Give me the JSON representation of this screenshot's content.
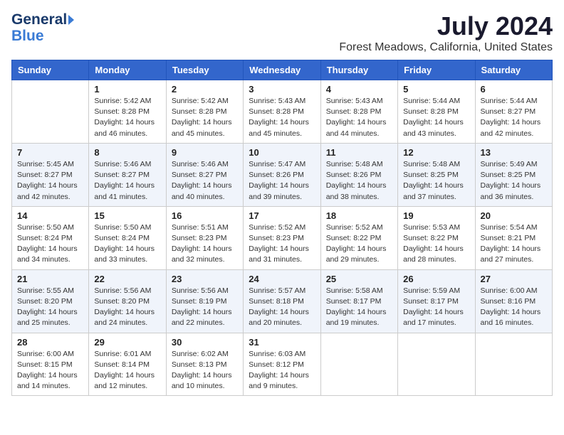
{
  "header": {
    "logo_general": "General",
    "logo_blue": "Blue",
    "month_year": "July 2024",
    "location": "Forest Meadows, California, United States"
  },
  "days_of_week": [
    "Sunday",
    "Monday",
    "Tuesday",
    "Wednesday",
    "Thursday",
    "Friday",
    "Saturday"
  ],
  "weeks": [
    [
      {
        "day": "",
        "info": ""
      },
      {
        "day": "1",
        "info": "Sunrise: 5:42 AM\nSunset: 8:28 PM\nDaylight: 14 hours\nand 46 minutes."
      },
      {
        "day": "2",
        "info": "Sunrise: 5:42 AM\nSunset: 8:28 PM\nDaylight: 14 hours\nand 45 minutes."
      },
      {
        "day": "3",
        "info": "Sunrise: 5:43 AM\nSunset: 8:28 PM\nDaylight: 14 hours\nand 45 minutes."
      },
      {
        "day": "4",
        "info": "Sunrise: 5:43 AM\nSunset: 8:28 PM\nDaylight: 14 hours\nand 44 minutes."
      },
      {
        "day": "5",
        "info": "Sunrise: 5:44 AM\nSunset: 8:28 PM\nDaylight: 14 hours\nand 43 minutes."
      },
      {
        "day": "6",
        "info": "Sunrise: 5:44 AM\nSunset: 8:27 PM\nDaylight: 14 hours\nand 42 minutes."
      }
    ],
    [
      {
        "day": "7",
        "info": "Sunrise: 5:45 AM\nSunset: 8:27 PM\nDaylight: 14 hours\nand 42 minutes."
      },
      {
        "day": "8",
        "info": "Sunrise: 5:46 AM\nSunset: 8:27 PM\nDaylight: 14 hours\nand 41 minutes."
      },
      {
        "day": "9",
        "info": "Sunrise: 5:46 AM\nSunset: 8:27 PM\nDaylight: 14 hours\nand 40 minutes."
      },
      {
        "day": "10",
        "info": "Sunrise: 5:47 AM\nSunset: 8:26 PM\nDaylight: 14 hours\nand 39 minutes."
      },
      {
        "day": "11",
        "info": "Sunrise: 5:48 AM\nSunset: 8:26 PM\nDaylight: 14 hours\nand 38 minutes."
      },
      {
        "day": "12",
        "info": "Sunrise: 5:48 AM\nSunset: 8:25 PM\nDaylight: 14 hours\nand 37 minutes."
      },
      {
        "day": "13",
        "info": "Sunrise: 5:49 AM\nSunset: 8:25 PM\nDaylight: 14 hours\nand 36 minutes."
      }
    ],
    [
      {
        "day": "14",
        "info": "Sunrise: 5:50 AM\nSunset: 8:24 PM\nDaylight: 14 hours\nand 34 minutes."
      },
      {
        "day": "15",
        "info": "Sunrise: 5:50 AM\nSunset: 8:24 PM\nDaylight: 14 hours\nand 33 minutes."
      },
      {
        "day": "16",
        "info": "Sunrise: 5:51 AM\nSunset: 8:23 PM\nDaylight: 14 hours\nand 32 minutes."
      },
      {
        "day": "17",
        "info": "Sunrise: 5:52 AM\nSunset: 8:23 PM\nDaylight: 14 hours\nand 31 minutes."
      },
      {
        "day": "18",
        "info": "Sunrise: 5:52 AM\nSunset: 8:22 PM\nDaylight: 14 hours\nand 29 minutes."
      },
      {
        "day": "19",
        "info": "Sunrise: 5:53 AM\nSunset: 8:22 PM\nDaylight: 14 hours\nand 28 minutes."
      },
      {
        "day": "20",
        "info": "Sunrise: 5:54 AM\nSunset: 8:21 PM\nDaylight: 14 hours\nand 27 minutes."
      }
    ],
    [
      {
        "day": "21",
        "info": "Sunrise: 5:55 AM\nSunset: 8:20 PM\nDaylight: 14 hours\nand 25 minutes."
      },
      {
        "day": "22",
        "info": "Sunrise: 5:56 AM\nSunset: 8:20 PM\nDaylight: 14 hours\nand 24 minutes."
      },
      {
        "day": "23",
        "info": "Sunrise: 5:56 AM\nSunset: 8:19 PM\nDaylight: 14 hours\nand 22 minutes."
      },
      {
        "day": "24",
        "info": "Sunrise: 5:57 AM\nSunset: 8:18 PM\nDaylight: 14 hours\nand 20 minutes."
      },
      {
        "day": "25",
        "info": "Sunrise: 5:58 AM\nSunset: 8:17 PM\nDaylight: 14 hours\nand 19 minutes."
      },
      {
        "day": "26",
        "info": "Sunrise: 5:59 AM\nSunset: 8:17 PM\nDaylight: 14 hours\nand 17 minutes."
      },
      {
        "day": "27",
        "info": "Sunrise: 6:00 AM\nSunset: 8:16 PM\nDaylight: 14 hours\nand 16 minutes."
      }
    ],
    [
      {
        "day": "28",
        "info": "Sunrise: 6:00 AM\nSunset: 8:15 PM\nDaylight: 14 hours\nand 14 minutes."
      },
      {
        "day": "29",
        "info": "Sunrise: 6:01 AM\nSunset: 8:14 PM\nDaylight: 14 hours\nand 12 minutes."
      },
      {
        "day": "30",
        "info": "Sunrise: 6:02 AM\nSunset: 8:13 PM\nDaylight: 14 hours\nand 10 minutes."
      },
      {
        "day": "31",
        "info": "Sunrise: 6:03 AM\nSunset: 8:12 PM\nDaylight: 14 hours\nand 9 minutes."
      },
      {
        "day": "",
        "info": ""
      },
      {
        "day": "",
        "info": ""
      },
      {
        "day": "",
        "info": ""
      }
    ]
  ]
}
